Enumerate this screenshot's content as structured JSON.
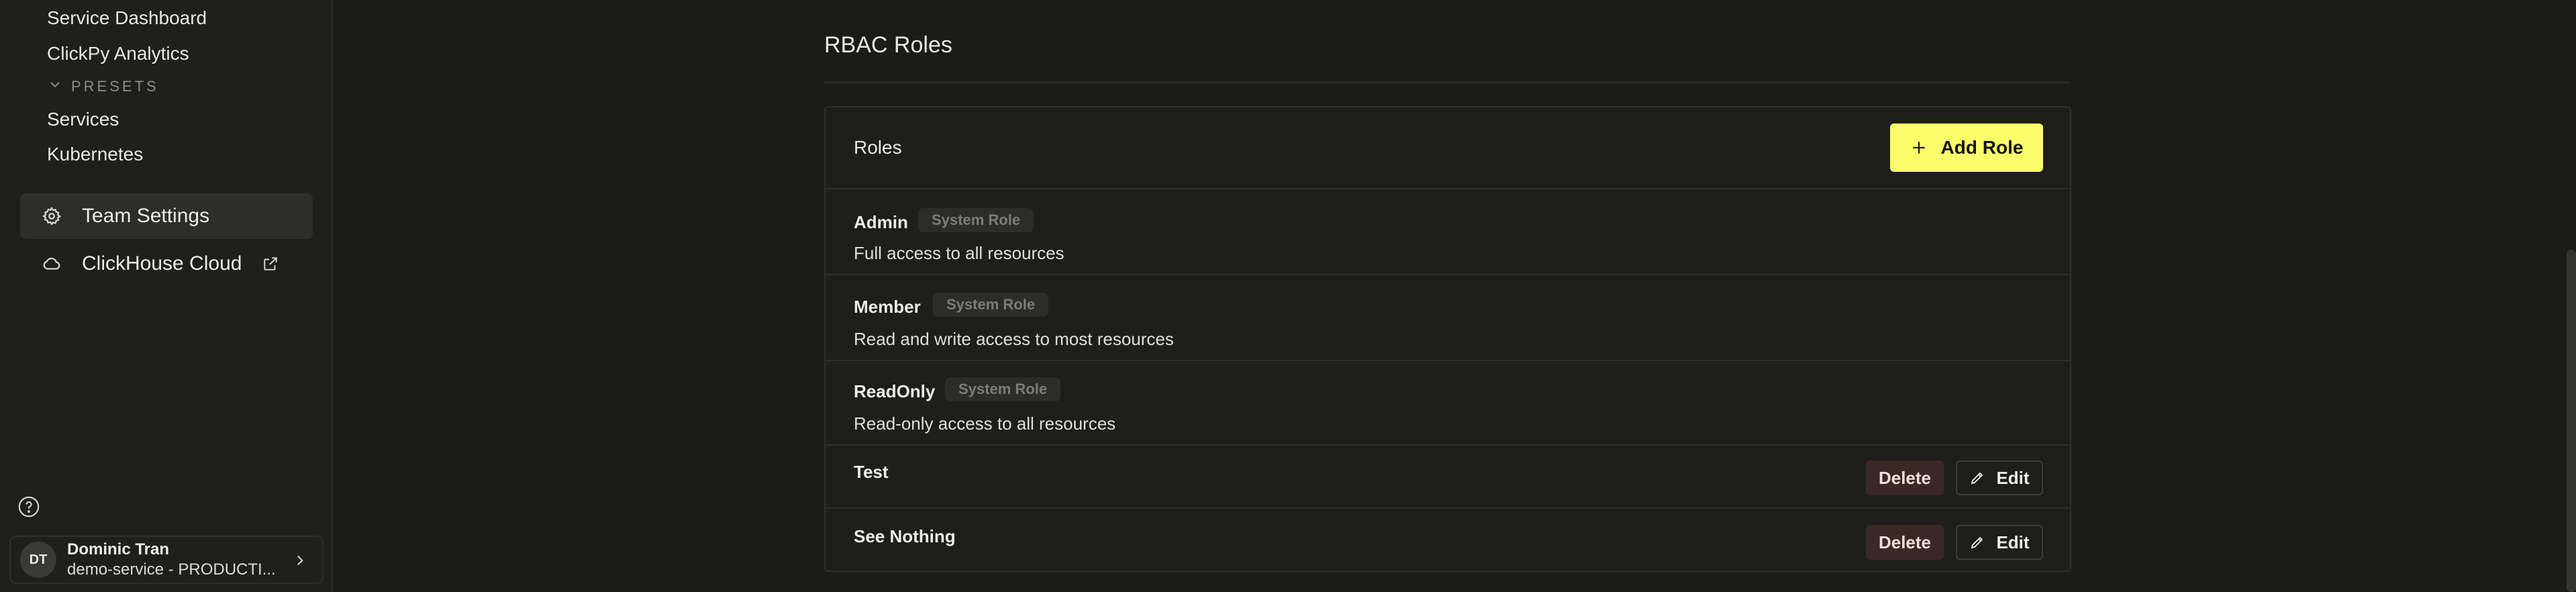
{
  "sidebar": {
    "links": [
      "Service Dashboard",
      "ClickPy Analytics"
    ],
    "presets_header": "PRESETS",
    "presets": [
      "Services",
      "Kubernetes"
    ],
    "team_settings": "Team Settings",
    "clickhouse_cloud": "ClickHouse Cloud",
    "user": {
      "initials": "DT",
      "name": "Dominic Tran",
      "subtitle": "demo-service - PRODUCTI..."
    }
  },
  "main": {
    "title": "RBAC Roles",
    "card_title": "Roles",
    "add_button": "Add Role",
    "delete_label": "Delete",
    "edit_label": "Edit",
    "system_badge": "System Role",
    "roles": [
      {
        "name": "Admin",
        "description": "Full access to all resources",
        "system": true
      },
      {
        "name": "Member",
        "description": "Read and write access to most resources",
        "system": true
      },
      {
        "name": "ReadOnly",
        "description": "Read-only access to all resources",
        "system": true
      },
      {
        "name": "Test",
        "description": "",
        "system": false
      },
      {
        "name": "See Nothing",
        "description": "",
        "system": false
      }
    ]
  },
  "colors": {
    "accent": "#faff69",
    "background": "#1b1b18",
    "delete_bg": "#3a2826"
  }
}
